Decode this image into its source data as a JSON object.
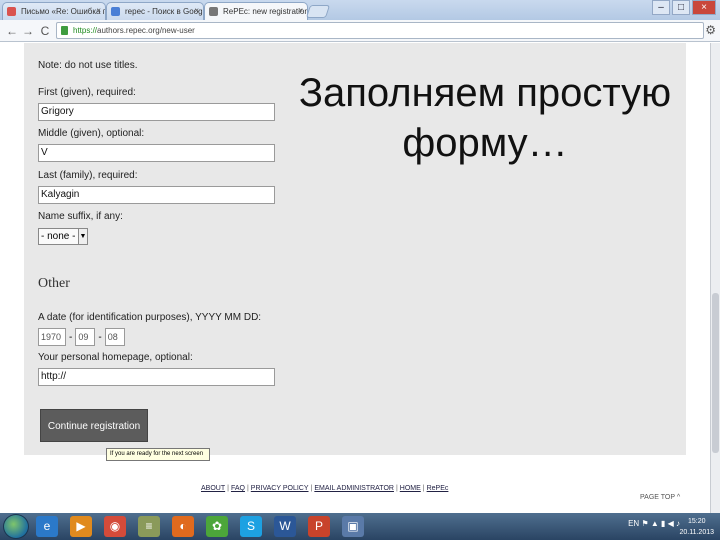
{
  "browser": {
    "tabs": [
      {
        "label": "Письмо «Re: Ошибка при»",
        "close": "×",
        "icon_color": "#d9534f"
      },
      {
        "label": "repec - Поиск в Google",
        "close": "×",
        "icon_color": "#4a7fd6"
      },
      {
        "label": "RePEc: new registration",
        "close": "×",
        "icon_color": "#777777"
      }
    ],
    "window_buttons": {
      "minimize": "–",
      "restore": "□",
      "close": "×"
    },
    "nav": {
      "back": "←",
      "forward": "→",
      "reload": "C"
    },
    "url_scheme": "https://",
    "url_rest": "authors.repec.org/new-user",
    "menu_icon": "wrench-icon"
  },
  "form": {
    "note": "Note: do not use titles.",
    "first_label": "First (given), required:",
    "first_value": "Grigory",
    "middle_label": "Middle (given), optional:",
    "middle_value": "V",
    "last_label": "Last (family), required:",
    "last_value": "Kalyagin",
    "suffix_label": "Name suffix, if any:",
    "suffix_value": "- none -",
    "other_heading": "Other",
    "date_label": "A date (for identification purposes), YYYY MM DD:",
    "date_year": "1970",
    "date_month": "09",
    "date_day": "08",
    "date_sep": "-",
    "homepage_label": "Your personal homepage, optional:",
    "homepage_value": "http://",
    "continue_label": "Continue registration",
    "tooltip": "If you are ready for the next screen"
  },
  "footer": {
    "links": [
      "ABOUT",
      "FAQ",
      "PRIVACY POLICY",
      "EMAIL ADMINISTRATOR",
      "HOME",
      "RePEc"
    ],
    "separator": "|",
    "page_top": "PAGE TOP ^"
  },
  "overlay": {
    "line1": "Заполняем простую",
    "line2": "форму…"
  },
  "taskbar": {
    "apps": [
      {
        "name": "ie-icon",
        "glyph": "e",
        "color": "#2b79c9"
      },
      {
        "name": "media-player-icon",
        "glyph": "▶",
        "color": "#e08a1e"
      },
      {
        "name": "chrome-icon",
        "glyph": "◉",
        "color": "#d44b3a"
      },
      {
        "name": "notepad-icon",
        "glyph": "≡",
        "color": "#8a9a5a"
      },
      {
        "name": "firefox-icon",
        "glyph": "◐",
        "color": "#e06a1e"
      },
      {
        "name": "icq-icon",
        "glyph": "✿",
        "color": "#4ca63a"
      },
      {
        "name": "skype-icon",
        "glyph": "S",
        "color": "#1da1e2"
      },
      {
        "name": "word-icon",
        "glyph": "W",
        "color": "#2b5797"
      },
      {
        "name": "powerpoint-icon",
        "glyph": "P",
        "color": "#c8432b"
      },
      {
        "name": "picture-viewer-icon",
        "glyph": "▣",
        "color": "#5a7aa8"
      }
    ],
    "lang": "EN",
    "time": "15:20",
    "date": "20.11.2013"
  }
}
